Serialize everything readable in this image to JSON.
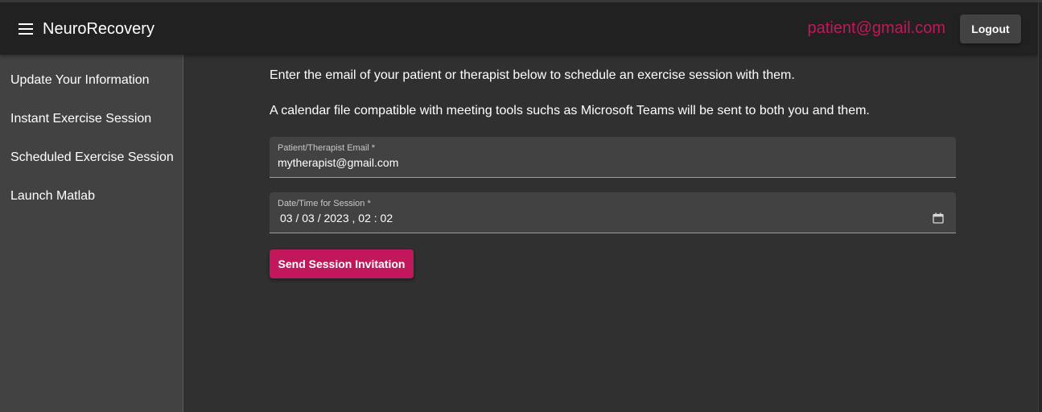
{
  "header": {
    "title": "NeuroRecovery",
    "user_email": "patient@gmail.com",
    "logout_label": "Logout",
    "menu_icon": "hamburger-menu-icon"
  },
  "sidebar": {
    "items": [
      {
        "label": "Update Your Information"
      },
      {
        "label": "Instant Exercise Session"
      },
      {
        "label": "Scheduled Exercise Session"
      },
      {
        "label": "Launch Matlab"
      }
    ]
  },
  "main": {
    "intro_line_1": "Enter the email of your patient or therapist below to schedule an exercise session with them.",
    "intro_line_2": "A calendar file compatible with meeting tools suchs as Microsoft Teams will be sent to both you and them.",
    "email_field": {
      "label": "Patient/Therapist Email *",
      "value": "mytherapist@gmail.com"
    },
    "datetime_field": {
      "label": "Date/Time for Session *",
      "value": "03 / 03 / 2023 ,  02 : 02",
      "icon": "calendar-icon"
    },
    "send_label": "Send Session Invitation"
  },
  "colors": {
    "accent": "#c2185b",
    "app_bar": "#212121",
    "sidebar": "#424242",
    "main_bg": "#303030"
  }
}
